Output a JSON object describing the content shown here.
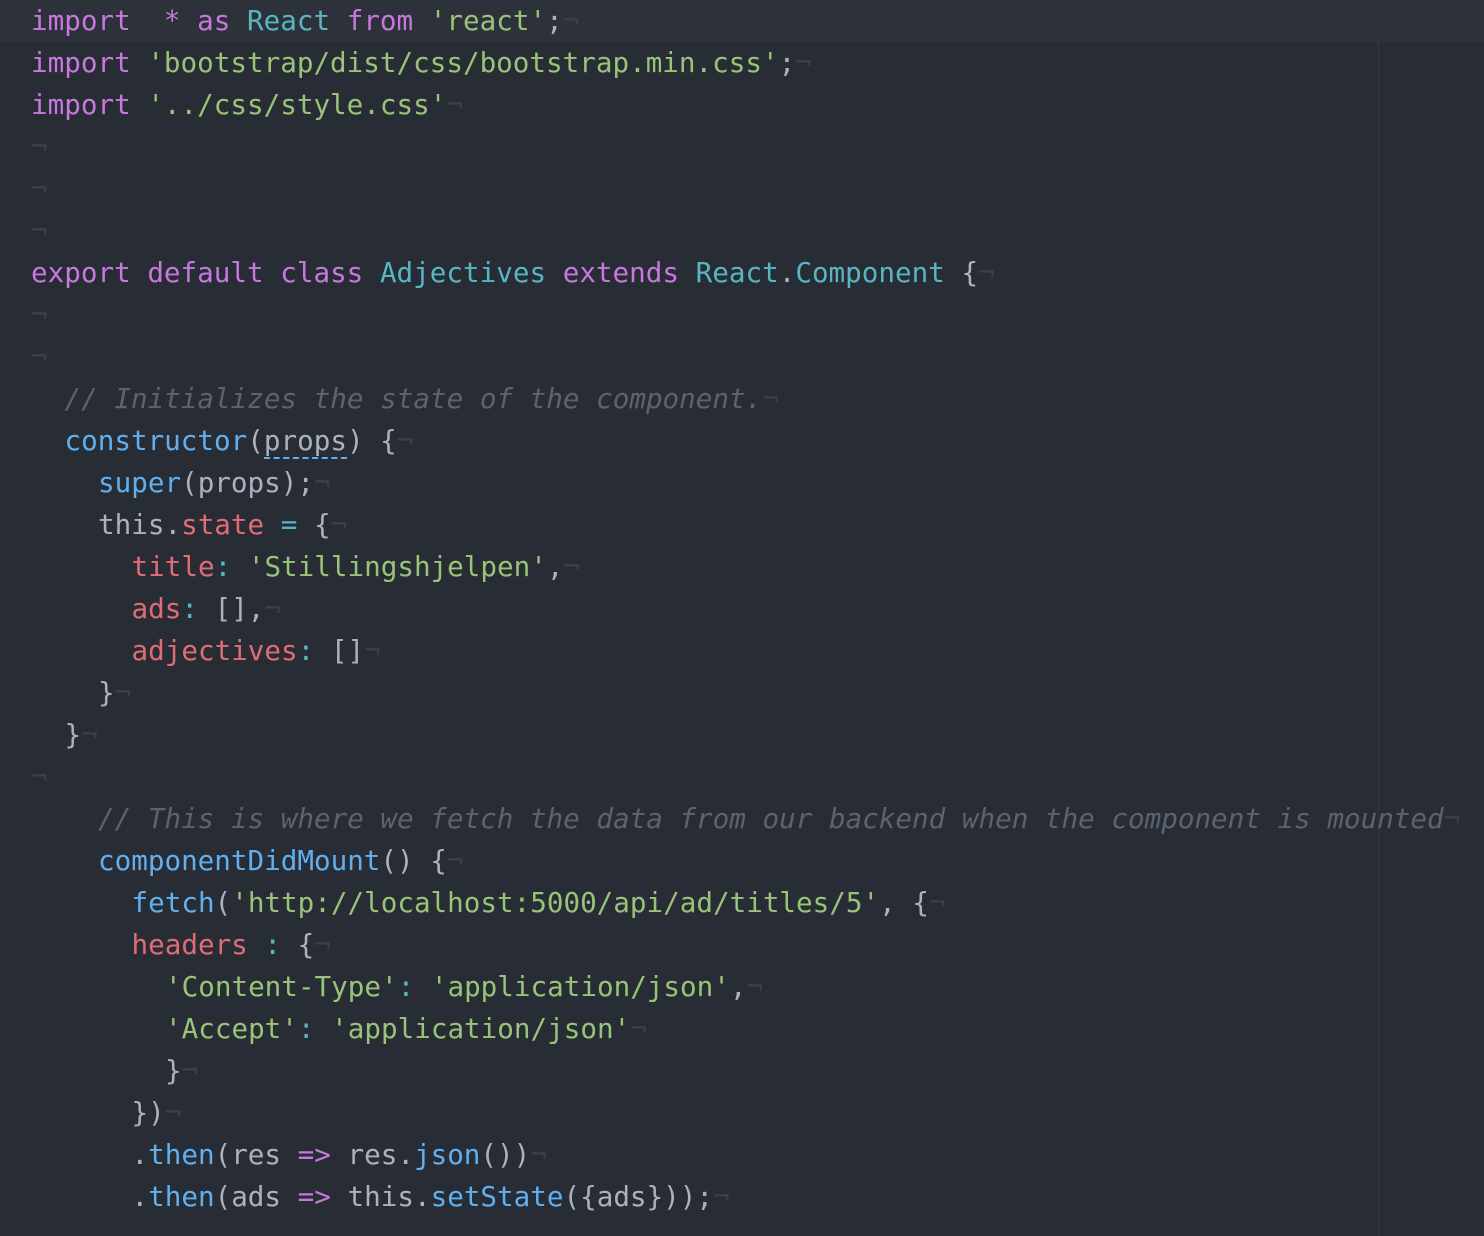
{
  "editor": {
    "language": "javascript",
    "theme_colors": {
      "background": "#282c34",
      "keyword": "#c678dd",
      "string": "#98c379",
      "comment": "#5c6370",
      "function": "#61afef",
      "type": "#56b6c2",
      "property": "#e06c75",
      "plain": "#abb2bf"
    },
    "eol_glyph": "¬",
    "lines": [
      {
        "indent": 0,
        "tokens": [
          [
            "k",
            "import"
          ],
          [
            "",
            "  "
          ],
          [
            "k",
            "* as"
          ],
          [
            "",
            " "
          ],
          [
            "t",
            "React"
          ],
          [
            "",
            " "
          ],
          [
            "k",
            "from"
          ],
          [
            "",
            " "
          ],
          [
            "s",
            "'react'"
          ],
          [
            "",
            ";"
          ]
        ]
      },
      {
        "indent": 0,
        "tokens": [
          [
            "k",
            "import"
          ],
          [
            "",
            " "
          ],
          [
            "s",
            "'bootstrap/dist/css/bootstrap.min.css'"
          ],
          [
            "",
            ";"
          ]
        ]
      },
      {
        "indent": 0,
        "tokens": [
          [
            "k",
            "import"
          ],
          [
            "",
            " "
          ],
          [
            "s",
            "'../css/style.css'"
          ]
        ]
      },
      {
        "indent": 0,
        "tokens": []
      },
      {
        "indent": 0,
        "tokens": []
      },
      {
        "indent": 0,
        "tokens": []
      },
      {
        "indent": 0,
        "tokens": [
          [
            "k",
            "export"
          ],
          [
            "",
            " "
          ],
          [
            "k",
            "default"
          ],
          [
            "",
            " "
          ],
          [
            "k",
            "class"
          ],
          [
            "",
            " "
          ],
          [
            "t",
            "Adjectives"
          ],
          [
            "",
            " "
          ],
          [
            "k",
            "extends"
          ],
          [
            "",
            " "
          ],
          [
            "t",
            "React"
          ],
          [
            "",
            "."
          ],
          [
            "t",
            "Component"
          ],
          [
            "",
            " {"
          ]
        ]
      },
      {
        "indent": 0,
        "tokens": []
      },
      {
        "indent": 0,
        "tokens": []
      },
      {
        "indent": 1,
        "tokens": [
          [
            "c",
            "// Initializes the state of the component."
          ]
        ]
      },
      {
        "indent": 1,
        "tokens": [
          [
            "f",
            "constructor"
          ],
          [
            "",
            "("
          ],
          [
            "squig",
            "props"
          ],
          [
            "",
            ") {"
          ]
        ]
      },
      {
        "indent": 2,
        "tokens": [
          [
            "f",
            "super"
          ],
          [
            "",
            "(props);"
          ]
        ]
      },
      {
        "indent": 2,
        "tokens": [
          [
            "",
            "this."
          ],
          [
            "p",
            "state"
          ],
          [
            "",
            " "
          ],
          [
            "o",
            "="
          ],
          [
            "",
            " {"
          ]
        ]
      },
      {
        "indent": 3,
        "tokens": [
          [
            "p",
            "title"
          ],
          [
            "o",
            ":"
          ],
          [
            "",
            " "
          ],
          [
            "s",
            "'Stillingshjelpen'"
          ],
          [
            "",
            ","
          ]
        ]
      },
      {
        "indent": 3,
        "tokens": [
          [
            "p",
            "ads"
          ],
          [
            "o",
            ":"
          ],
          [
            "",
            " [],"
          ]
        ]
      },
      {
        "indent": 3,
        "tokens": [
          [
            "p",
            "adjectives"
          ],
          [
            "o",
            ":"
          ],
          [
            "",
            " []"
          ]
        ]
      },
      {
        "indent": 2,
        "tokens": [
          [
            "",
            "}"
          ]
        ]
      },
      {
        "indent": 1,
        "tokens": [
          [
            "",
            "}"
          ]
        ]
      },
      {
        "indent": 0,
        "tokens": []
      },
      {
        "indent": 2,
        "tokens": [
          [
            "c",
            "// This is where we fetch the data from our backend when the component is mounted"
          ]
        ]
      },
      {
        "indent": 2,
        "tokens": [
          [
            "f",
            "componentDidMount"
          ],
          [
            "",
            "() {"
          ]
        ]
      },
      {
        "indent": 3,
        "tokens": [
          [
            "f",
            "fetch"
          ],
          [
            "",
            "("
          ],
          [
            "s",
            "'http://localhost:5000/api/ad/titles/5'"
          ],
          [
            "",
            ", {"
          ]
        ]
      },
      {
        "indent": 3,
        "tokens": [
          [
            "p",
            "headers"
          ],
          [
            "",
            " "
          ],
          [
            "o",
            ":"
          ],
          [
            "",
            " {"
          ]
        ]
      },
      {
        "indent": 4,
        "tokens": [
          [
            "s",
            "'Content-Type'"
          ],
          [
            "o",
            ":"
          ],
          [
            "",
            " "
          ],
          [
            "s",
            "'application/json'"
          ],
          [
            "",
            ","
          ]
        ]
      },
      {
        "indent": 4,
        "tokens": [
          [
            "s",
            "'Accept'"
          ],
          [
            "o",
            ":"
          ],
          [
            "",
            " "
          ],
          [
            "s",
            "'application/json'"
          ]
        ]
      },
      {
        "indent": 4,
        "tokens": [
          [
            "",
            "}"
          ]
        ]
      },
      {
        "indent": 3,
        "tokens": [
          [
            "",
            "})"
          ]
        ]
      },
      {
        "indent": 3,
        "tokens": [
          [
            "",
            "."
          ],
          [
            "f",
            "then"
          ],
          [
            "",
            "(res "
          ],
          [
            "k",
            "=>"
          ],
          [
            "",
            " res."
          ],
          [
            "f",
            "json"
          ],
          [
            "",
            "())"
          ]
        ]
      },
      {
        "indent": 3,
        "tokens": [
          [
            "",
            "."
          ],
          [
            "f",
            "then"
          ],
          [
            "",
            "(ads "
          ],
          [
            "k",
            "=>"
          ],
          [
            "",
            " this."
          ],
          [
            "f",
            "setState"
          ],
          [
            "",
            "({ads}));"
          ]
        ]
      }
    ]
  }
}
